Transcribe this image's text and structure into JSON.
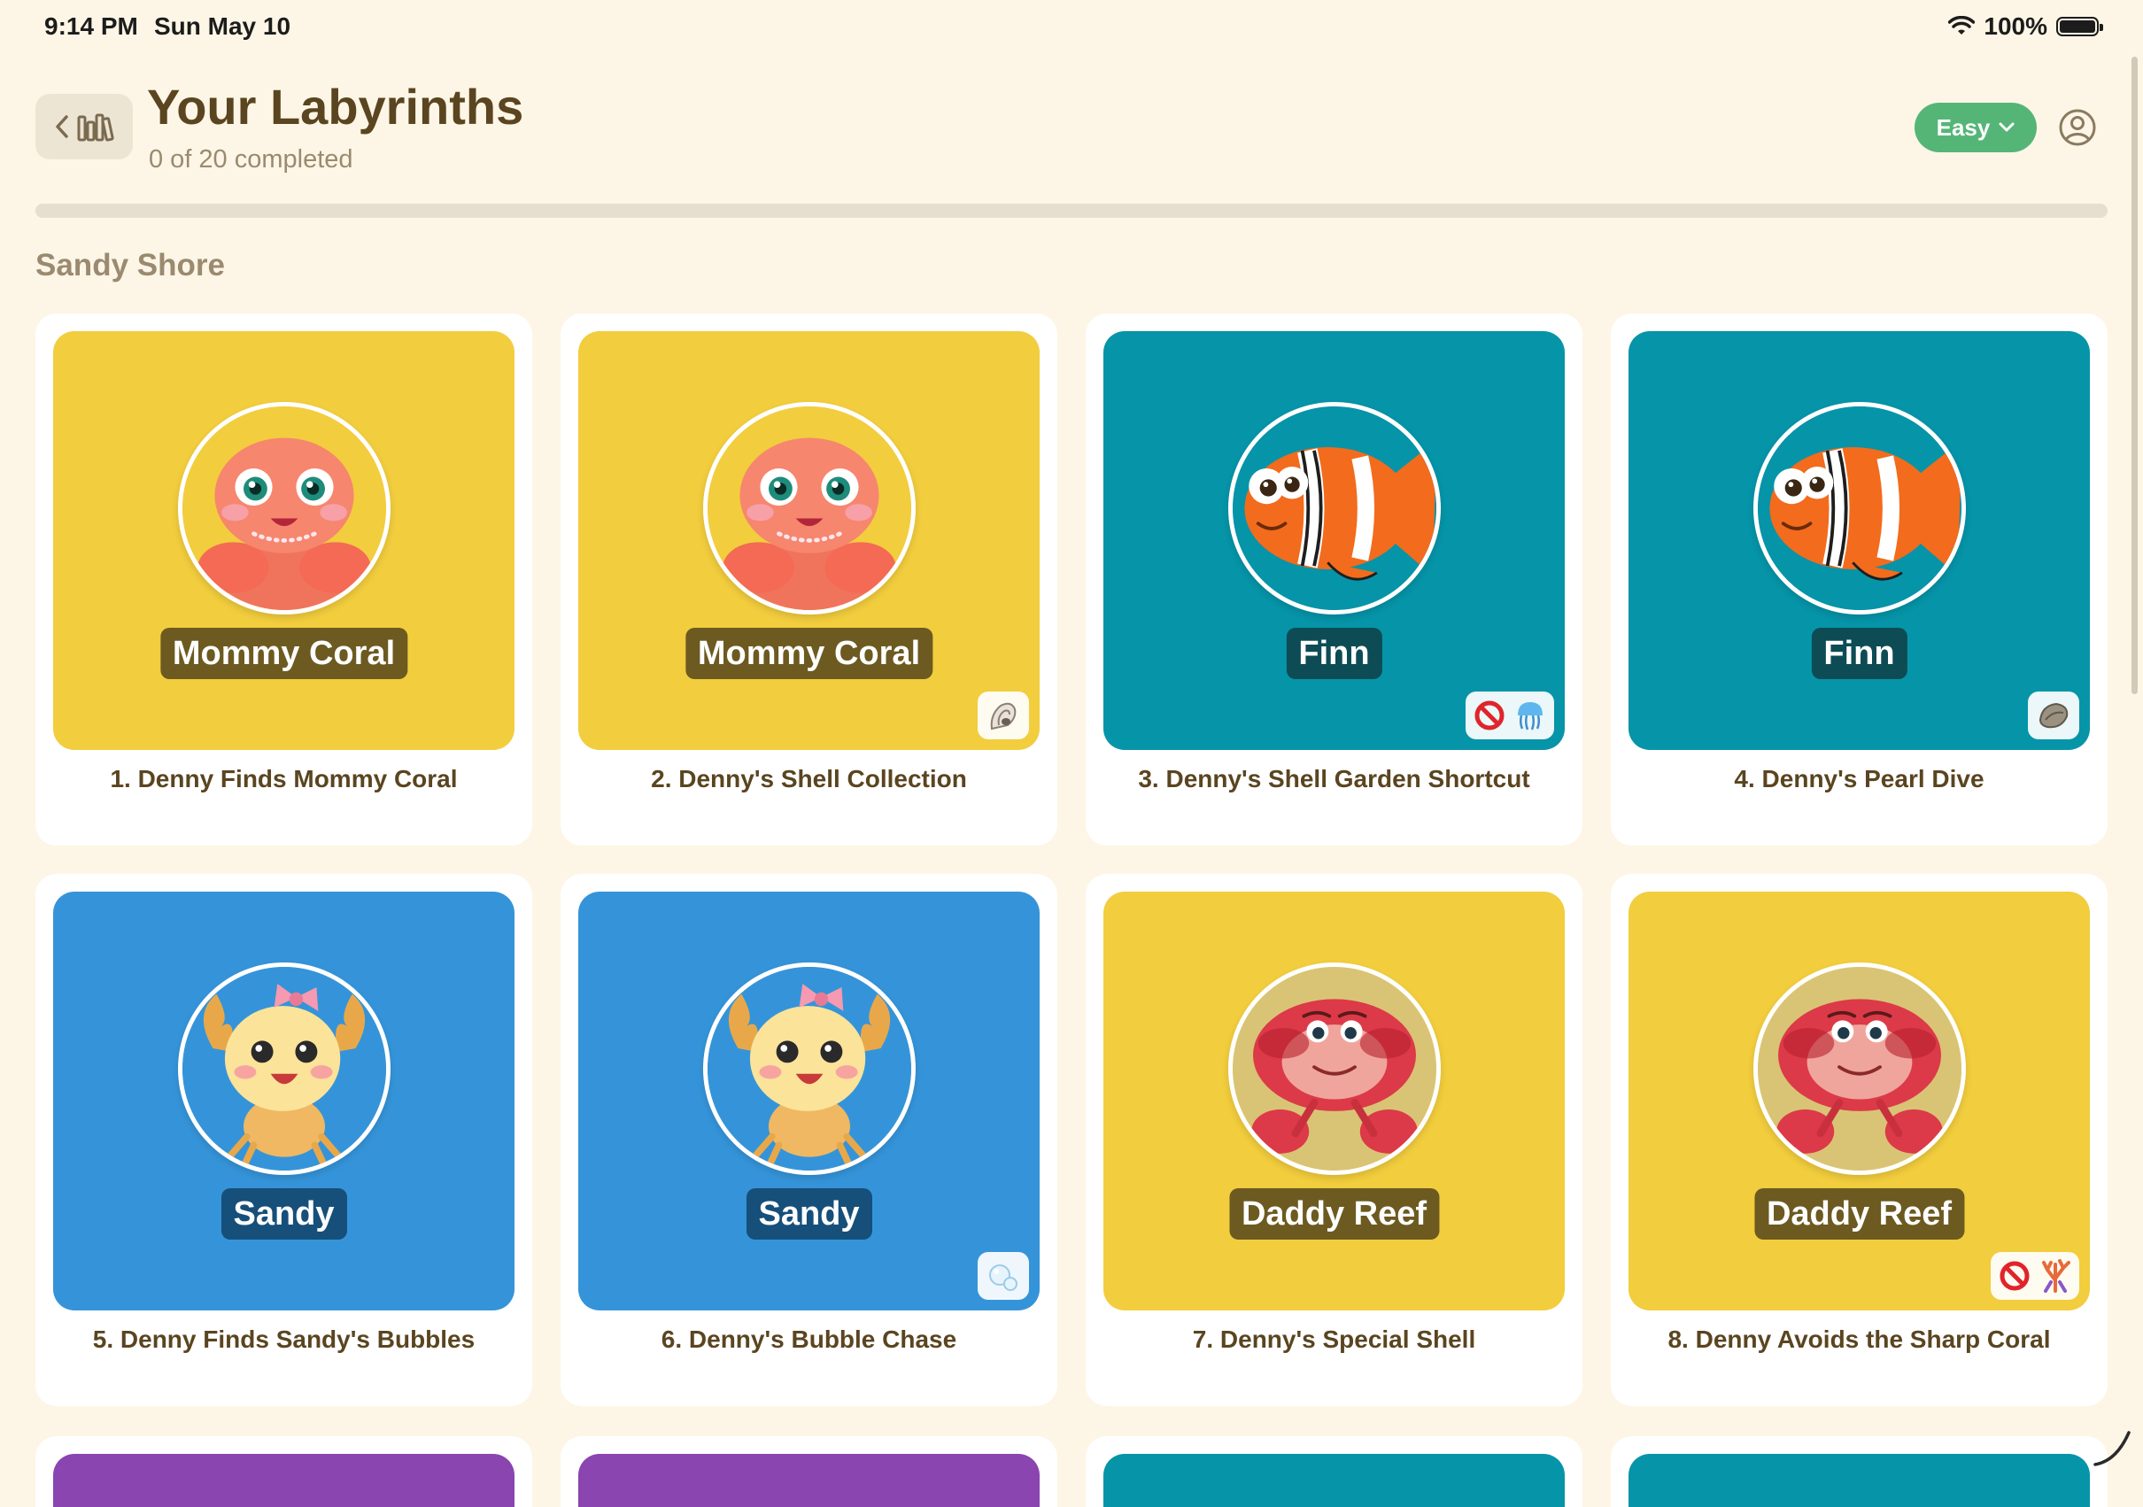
{
  "status_bar": {
    "time": "9:14 PM",
    "date": "Sun May 10",
    "battery": "100%"
  },
  "header": {
    "title": "Your Labyrinths",
    "subtitle": "0 of 20 completed",
    "difficulty": "Easy",
    "progress": 0,
    "colors": {
      "accent": "#55b577",
      "background": "#fdf6e6",
      "title": "#5a4520"
    }
  },
  "section": {
    "title": "Sandy Shore"
  },
  "cards": [
    {
      "title": "1. Denny Finds Mommy Coral",
      "character": "Mommy Coral",
      "bg": "yellow",
      "avatar": "pink-crab",
      "items": []
    },
    {
      "title": "2. Denny's Shell Collection",
      "character": "Mommy Coral",
      "bg": "yellow",
      "avatar": "pink-crab",
      "items": [
        "spiral-shell-icon"
      ]
    },
    {
      "title": "3. Denny's Shell Garden Shortcut",
      "character": "Finn",
      "bg": "teal",
      "avatar": "clownfish",
      "items": [
        "no-entry-icon",
        "jellyfish-icon"
      ]
    },
    {
      "title": "4. Denny's Pearl Dive",
      "character": "Finn",
      "bg": "teal",
      "avatar": "clownfish",
      "items": [
        "oyster-icon"
      ]
    },
    {
      "title": "5. Denny Finds Sandy's Bubbles",
      "character": "Sandy",
      "bg": "blue",
      "avatar": "yellow-crab",
      "items": []
    },
    {
      "title": "6. Denny's Bubble Chase",
      "character": "Sandy",
      "bg": "blue",
      "avatar": "yellow-crab",
      "items": [
        "bubbles-icon"
      ]
    },
    {
      "title": "7. Denny's Special Shell",
      "character": "Daddy Reef",
      "bg": "yellow",
      "avatar": "red-crab",
      "items": []
    },
    {
      "title": "8. Denny Avoids the Sharp Coral",
      "character": "Daddy Reef",
      "bg": "yellow",
      "avatar": "red-crab",
      "items": [
        "no-entry-icon",
        "coral-icon"
      ]
    }
  ],
  "next_row_colors": [
    "purple",
    "purple",
    "teal",
    "teal"
  ]
}
